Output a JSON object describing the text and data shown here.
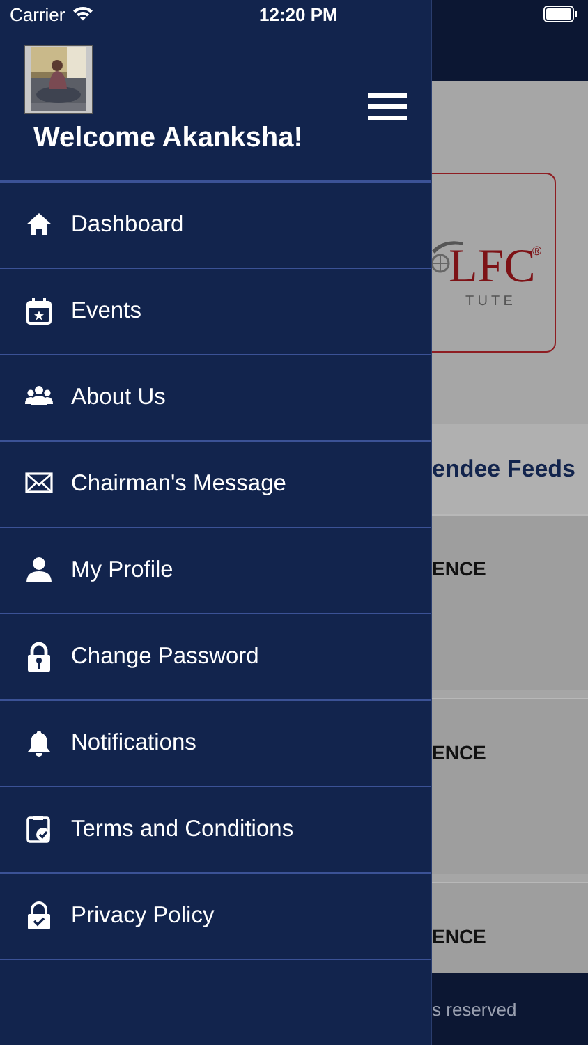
{
  "status_bar": {
    "carrier": "Carrier",
    "time": "12:20 PM"
  },
  "drawer": {
    "welcome": "Welcome Akanksha!",
    "items": [
      {
        "label": "Dashboard"
      },
      {
        "label": "Events"
      },
      {
        "label": "About Us"
      },
      {
        "label": "Chairman's Message"
      },
      {
        "label": "My Profile"
      },
      {
        "label": "Change Password"
      },
      {
        "label": "Notifications"
      },
      {
        "label": "Terms and Conditions"
      },
      {
        "label": "Privacy Policy"
      }
    ]
  },
  "background_screen": {
    "logo_text": "LFC",
    "logo_mark": "®",
    "logo_subtext": "T U T E",
    "section_title": "endee Feeds",
    "cards": [
      "ENCE",
      "ENCE",
      "ENCE"
    ],
    "footer": "s reserved"
  }
}
